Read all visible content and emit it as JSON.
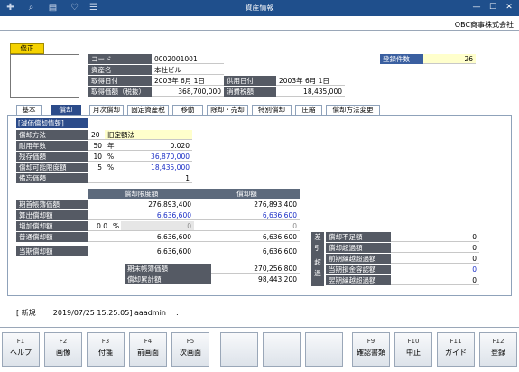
{
  "window": {
    "title": "資産情報",
    "company": "OBC商事株式会社"
  },
  "badge": {
    "label": "修正"
  },
  "info": {
    "code_label": "コード",
    "code": "0002001001",
    "name_label": "資産名",
    "name": "本社ビル",
    "acq_date_label": "取得日付",
    "acq_date": "2003年 6月 1日",
    "use_date_label": "供用日付",
    "use_date": "2003年 6月 1日",
    "acq_cost_label": "取得価額（税抜）",
    "acq_cost": "368,700,000",
    "tax_label": "消費税額",
    "tax": "18,435,000",
    "count_label": "登録件数",
    "count": "26"
  },
  "tabs": [
    "基本",
    "償却",
    "月次償却",
    "固定資産税",
    "移動",
    "除却・売却",
    "特別償却",
    "圧縮",
    "償却方法変更"
  ],
  "dep": {
    "section": "[減価償却情報]",
    "method_label": "償却方法",
    "method_code": "20",
    "method": "旧定額法",
    "life_label": "耐用年数",
    "life": "50",
    "life_unit": "年",
    "rate": "0.020",
    "residual_label": "残存価額",
    "residual_pct": "10",
    "pct": "%",
    "residual": "36,870,000",
    "limit_label": "償却可能限度額",
    "limit_pct": "5",
    "limit": "18,435,000",
    "memo_label": "備忘価額",
    "memo": "1"
  },
  "table": {
    "col1": "償却限度額",
    "col2": "償却額",
    "rows": [
      {
        "label": "期首帳簿価額",
        "v1": "276,893,400",
        "v2": "276,893,400",
        "blue": false
      },
      {
        "label": "算出償却額",
        "v1": "6,636,600",
        "v2": "6,636,600",
        "blue": true
      },
      {
        "label": "増加償却額",
        "pre": "0.0",
        "pct": "%",
        "v1": "0",
        "v2": "0",
        "gray": true
      },
      {
        "label": "普通償却額",
        "v1": "6,636,600",
        "v2": "6,636,600",
        "blue": false
      }
    ],
    "current_label": "当期償却額",
    "current1": "6,636,600",
    "current2": "6,636,600",
    "end_book_label": "期末帳簿価額",
    "end_book": "270,256,800",
    "cum_label": "償却累計額",
    "cum": "98,443,200"
  },
  "diff": {
    "side_top": "差引",
    "side_bottom": "超過",
    "items": [
      {
        "label": "償却不足額",
        "value": "0"
      },
      {
        "label": "償却超過額",
        "value": "0"
      },
      {
        "label": "前期繰越超過額",
        "value": "0"
      },
      {
        "label": "当期損金容認額",
        "value": "0"
      },
      {
        "label": "翌期繰越超過額",
        "value": "0"
      }
    ]
  },
  "status": {
    "mode": "[ 新規",
    "timestamp": "2019/07/25 15:25:05]",
    "user": "aaadmin",
    "extra": ":"
  },
  "fkeys": [
    {
      "key": "F1",
      "label": "ヘルプ"
    },
    {
      "key": "F2",
      "label": "画像"
    },
    {
      "key": "F3",
      "label": "付箋"
    },
    {
      "key": "F4",
      "label": "前画面"
    },
    {
      "key": "F5",
      "label": "次画面"
    },
    {
      "key": "",
      "label": ""
    },
    {
      "key": "",
      "label": ""
    },
    {
      "key": "",
      "label": ""
    },
    {
      "key": "F9",
      "label": "確認書類"
    },
    {
      "key": "F10",
      "label": "中止"
    },
    {
      "key": "F11",
      "label": "ガイド"
    },
    {
      "key": "F12",
      "label": "登録"
    }
  ]
}
